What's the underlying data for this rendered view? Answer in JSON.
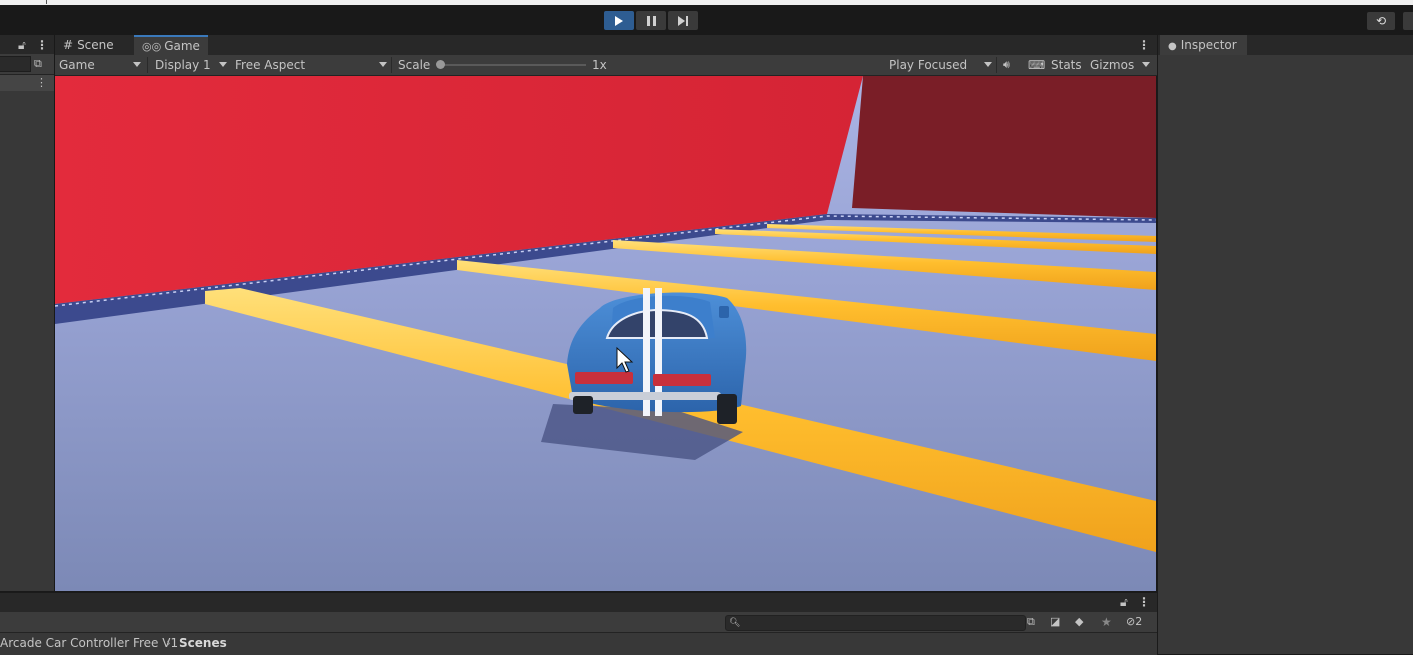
{
  "toolbar": {
    "play_icon": "play-icon",
    "pause_icon": "pause-icon",
    "step_icon": "step-icon",
    "history_icon": "history-icon"
  },
  "scene_tab": {
    "label": "Scene",
    "icon": "hash-grid-icon"
  },
  "game_tab": {
    "label": "Game",
    "icon": "gamepad-icon"
  },
  "game_toolbar": {
    "mode": "Game",
    "display": "Display 1",
    "aspect": "Free Aspect",
    "scale_label": "Scale",
    "scale_value": "1x",
    "play_mode": "Play Focused",
    "stats": "Stats",
    "gizmos": "Gizmos"
  },
  "inspector": {
    "tab_label": "Inspector",
    "icon": "info-icon"
  },
  "project": {
    "breadcrumb": [
      "Arcade Car Controller Free V1",
      "Scenes"
    ],
    "hidden_count": "2"
  },
  "colors": {
    "accent": "#3a79bb",
    "play_active": "#2e5d92",
    "wall_red": "#e1293b",
    "stripe_yellow": "#ffc130",
    "car_blue": "#3a78c4"
  }
}
